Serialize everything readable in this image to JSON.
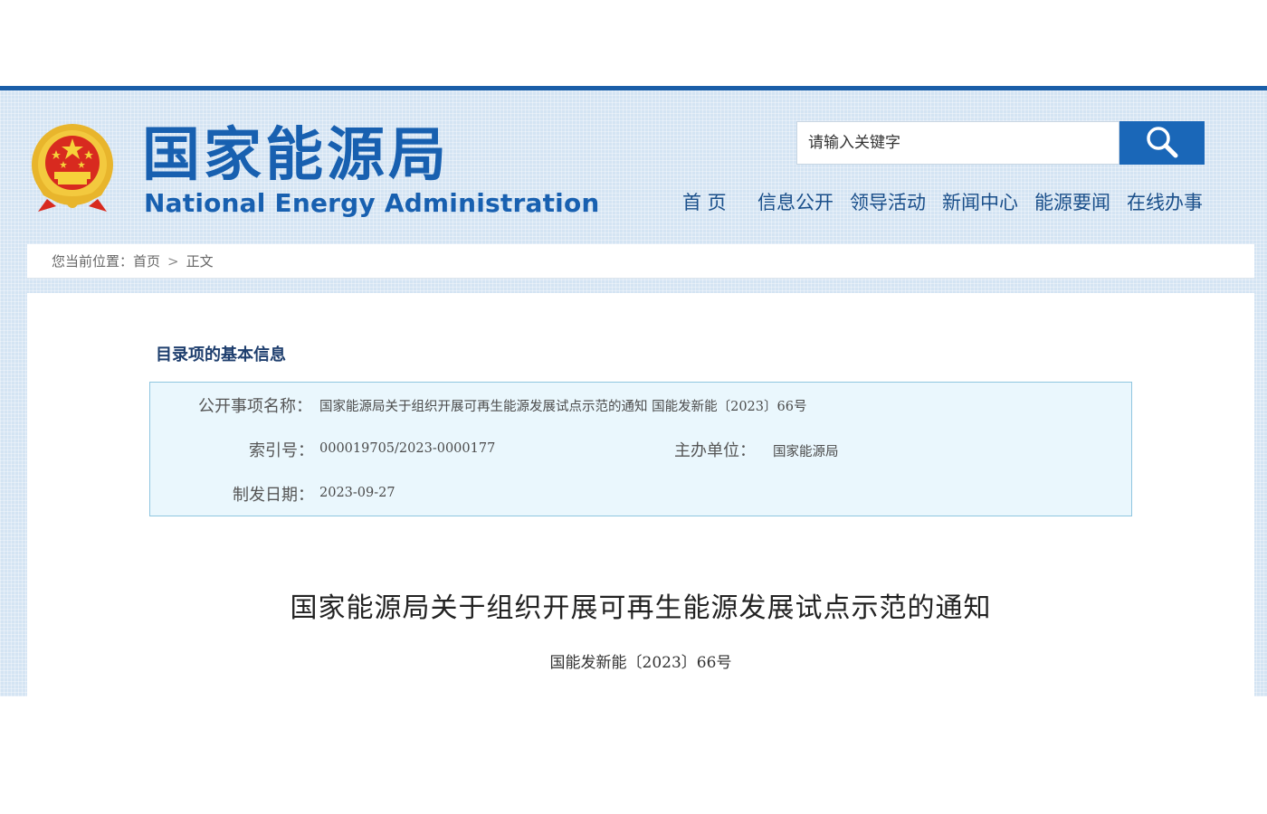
{
  "header": {
    "logo_cn": "国家能源局",
    "logo_en": "National Energy Administration",
    "search_placeholder": "请输入关键字"
  },
  "nav": {
    "items": [
      {
        "label": "首 页"
      },
      {
        "label": "信息公开"
      },
      {
        "label": "领导活动"
      },
      {
        "label": "新闻中心"
      },
      {
        "label": "能源要闻"
      },
      {
        "label": "在线办事"
      }
    ]
  },
  "breadcrumb": {
    "prefix": "您当前位置：",
    "home": "首页",
    "separator": ">",
    "current": "正文"
  },
  "catalog": {
    "section_title": "目录项的基本信息",
    "item_name_label": "公开事项名称：",
    "item_name_value": "国家能源局关于组织开展可再生能源发展试点示范的通知 国能发新能〔2023〕66号",
    "index_label": "索引号：",
    "index_value": "000019705/2023-0000177",
    "host_label": "主办单位：",
    "host_value": "国家能源局",
    "date_label": "制发日期：",
    "date_value": "2023-09-27"
  },
  "document": {
    "title": "国家能源局关于组织开展可再生能源发展试点示范的通知",
    "doc_number": "国能发新能〔2023〕66号"
  },
  "colors": {
    "brand_blue": "#1860b0",
    "bar_blue": "#1a5ea8",
    "search_button": "#1a67b8",
    "info_box_bg": "#eaf7fd",
    "info_box_border": "#8fc6e0"
  },
  "icons": {
    "emblem": "national-emblem-icon",
    "search": "search-icon"
  }
}
